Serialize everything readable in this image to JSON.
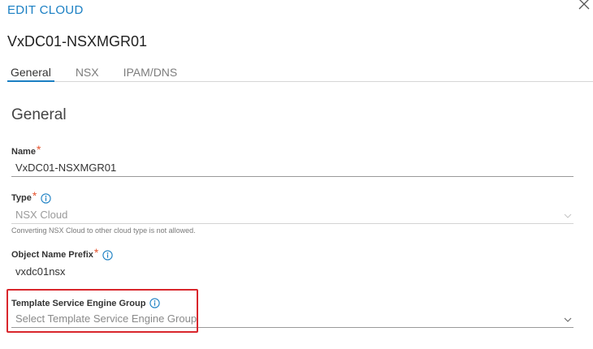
{
  "modal": {
    "kicker": "EDIT CLOUD",
    "cloud_name": "VxDC01-NSXMGR01"
  },
  "tabs": [
    {
      "label": "General",
      "active": true
    },
    {
      "label": "NSX",
      "active": false
    },
    {
      "label": "IPAM/DNS",
      "active": false
    }
  ],
  "section": {
    "title": "General"
  },
  "fields": {
    "name": {
      "label": "Name",
      "required": "*",
      "value": "VxDC01-NSXMGR01"
    },
    "type": {
      "label": "Type",
      "required": "*",
      "value": "NSX Cloud",
      "helper": "Converting NSX Cloud to other cloud type is not allowed."
    },
    "prefix": {
      "label": "Object Name Prefix",
      "required": "*",
      "value": "vxdc01nsx"
    },
    "template_seg": {
      "label": "Template Service Engine Group",
      "placeholder": "Select Template Service Engine Group"
    }
  },
  "icons": {
    "close": "close-icon",
    "info": "info-icon",
    "dropdown": "chevron-down-icon"
  },
  "colors": {
    "accent": "#1a7fc3",
    "required": "#e5522c",
    "highlight": "#d9262c"
  }
}
